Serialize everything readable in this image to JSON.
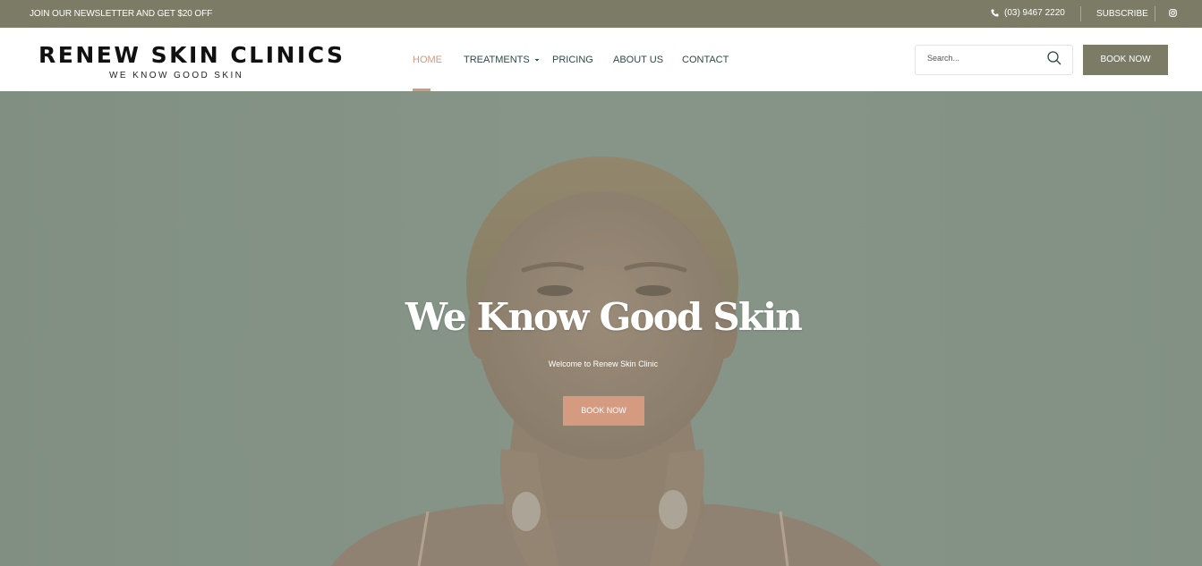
{
  "topbar": {
    "promo": "JOIN OUR NEWSLETTER AND GET $20 OFF",
    "phone_icon": "phone-icon",
    "phone": "(03) 9467 2220",
    "subscribe": "SUBSCRIBE",
    "social_icon": "instagram-icon",
    "bg_color": "#7b7b66"
  },
  "header": {
    "logo_title": "RENEW SKIN CLINICS",
    "logo_tagline": "WE KNOW GOOD SKIN",
    "nav": [
      {
        "label": "HOME",
        "active": true
      },
      {
        "label": "TREATMENTS",
        "dropdown": true
      },
      {
        "label": "PRICING"
      },
      {
        "label": "ABOUT US"
      },
      {
        "label": "CONTACT"
      }
    ],
    "dropdown_icon": "caret-down-icon",
    "search_placeholder": "Search...",
    "search_icon": "search-icon",
    "book_button": "BOOK NOW",
    "accent_color": "#d29a82",
    "nav_color": "#2c4a48"
  },
  "hero": {
    "title": "We Know Good Skin",
    "subtitle": "Welcome to Renew Skin Clinic",
    "button": "BOOK NOW",
    "button_color": "#d49b80"
  }
}
